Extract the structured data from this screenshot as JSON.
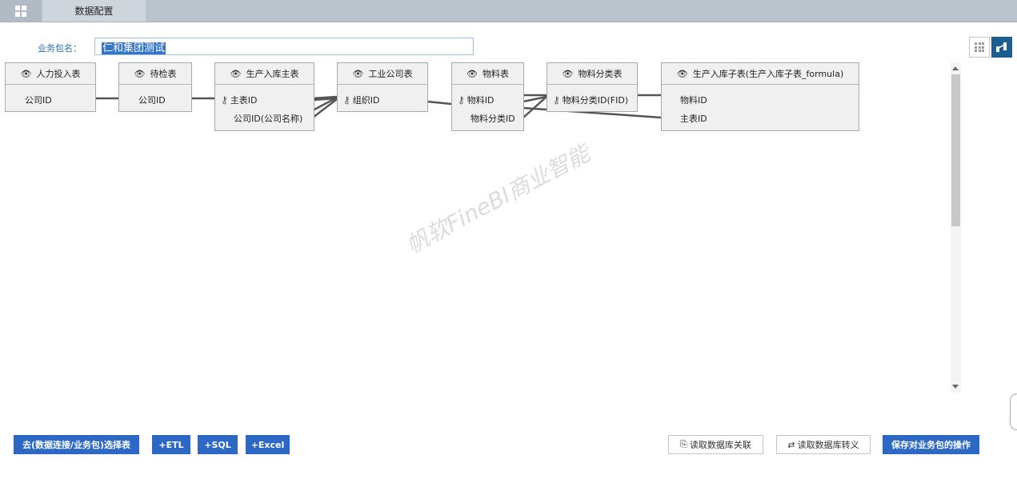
{
  "header": {
    "tab_label": "数据配置"
  },
  "package": {
    "label": "业务包名：",
    "name": "仁和集团测试"
  },
  "tables": [
    {
      "title": "人力投入表",
      "fields": [
        {
          "name": "公司ID",
          "key": false
        }
      ]
    },
    {
      "title": "待检表",
      "fields": [
        {
          "name": "公司ID",
          "key": false
        }
      ]
    },
    {
      "title": "生产入库主表",
      "fields": [
        {
          "name": "主表ID",
          "key": true
        },
        {
          "name": "公司ID(公司名称)",
          "key": false
        }
      ]
    },
    {
      "title": "工业公司表",
      "fields": [
        {
          "name": "组织ID",
          "key": true
        }
      ]
    },
    {
      "title": "物料表",
      "fields": [
        {
          "name": "物料ID",
          "key": true
        },
        {
          "name": "物料分类ID",
          "key": false
        }
      ]
    },
    {
      "title": "物料分类表",
      "fields": [
        {
          "name": "物料分类ID(FID)",
          "key": true
        }
      ]
    },
    {
      "title": "生产入库子表(生产入库子表_formula)",
      "fields": [
        {
          "name": "物料ID",
          "key": false
        },
        {
          "name": "主表ID",
          "key": false
        }
      ]
    }
  ],
  "watermark": "帆软FineBI商业智能",
  "buttons": {
    "select_table": "去(数据连接/业务包)选择表",
    "etl": "+ETL",
    "sql": "+SQL",
    "excel": "+Excel",
    "read_relation": "读取数据库关联",
    "read_escape": "读取数据库转义",
    "save": "保存对业务包的操作"
  },
  "colors": {
    "accent": "#2d68c4",
    "topbar": "#b9c3cc",
    "selected_text_bg": "#3375c6"
  }
}
